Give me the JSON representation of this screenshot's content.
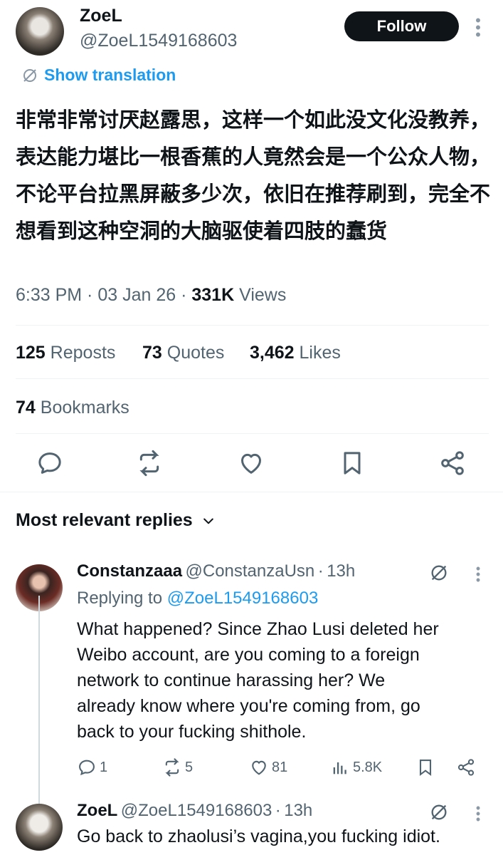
{
  "tweet": {
    "author_name": "ZoeL",
    "author_handle": "@ZoeL1549168603",
    "follow_label": "Follow",
    "translate_label": "Show translation",
    "text": "非常非常讨厌赵露思，这样一个如此没文化没教养，表达能力堪比一根香蕉的人竟然会是一个公众人物，不论平台拉黑屏蔽多少次，依旧在推荐刷到，完全不想看到这种空洞的大脑驱使着四肢的蠢货",
    "time": "6:33 PM",
    "date": "03 Jan 26",
    "views_count": "331K",
    "views_label": "Views",
    "reposts_count": "125",
    "reposts_label": "Reposts",
    "quotes_count": "73",
    "quotes_label": "Quotes",
    "likes_count": "3,462",
    "likes_label": "Likes",
    "bookmarks_count": "74",
    "bookmarks_label": "Bookmarks",
    "icons": [
      "reply-icon",
      "repost-icon",
      "like-icon",
      "bookmark-icon",
      "share-icon"
    ]
  },
  "replies_section": {
    "title": "Most relevant replies"
  },
  "replies": [
    {
      "name": "Constanzaaa",
      "handle": "@ConstanzaUsn",
      "age": "13h",
      "replying_prefix": "Replying to",
      "replying_handle": "@ZoeL1549168603",
      "text_lines": [
        "What happened? Since Zhao Lusi deleted her",
        "Weibo account, are you coming to a foreign",
        "network to continue harassing her? We",
        "already know where you're coming from, go",
        "back to your fucking shithole."
      ],
      "replies": "1",
      "reposts": "5",
      "likes": "81",
      "views": "5.8K"
    },
    {
      "name": "ZoeL",
      "handle": "@ZoeL1549168603",
      "age": "13h",
      "text": "Go back to zhaolusi’s vagina,you fucking idiot."
    }
  ],
  "colors": {
    "link": "#1d9bf0",
    "secondary_text": "#536471",
    "primary_text": "#0f1419",
    "divider": "#eff3f4"
  }
}
